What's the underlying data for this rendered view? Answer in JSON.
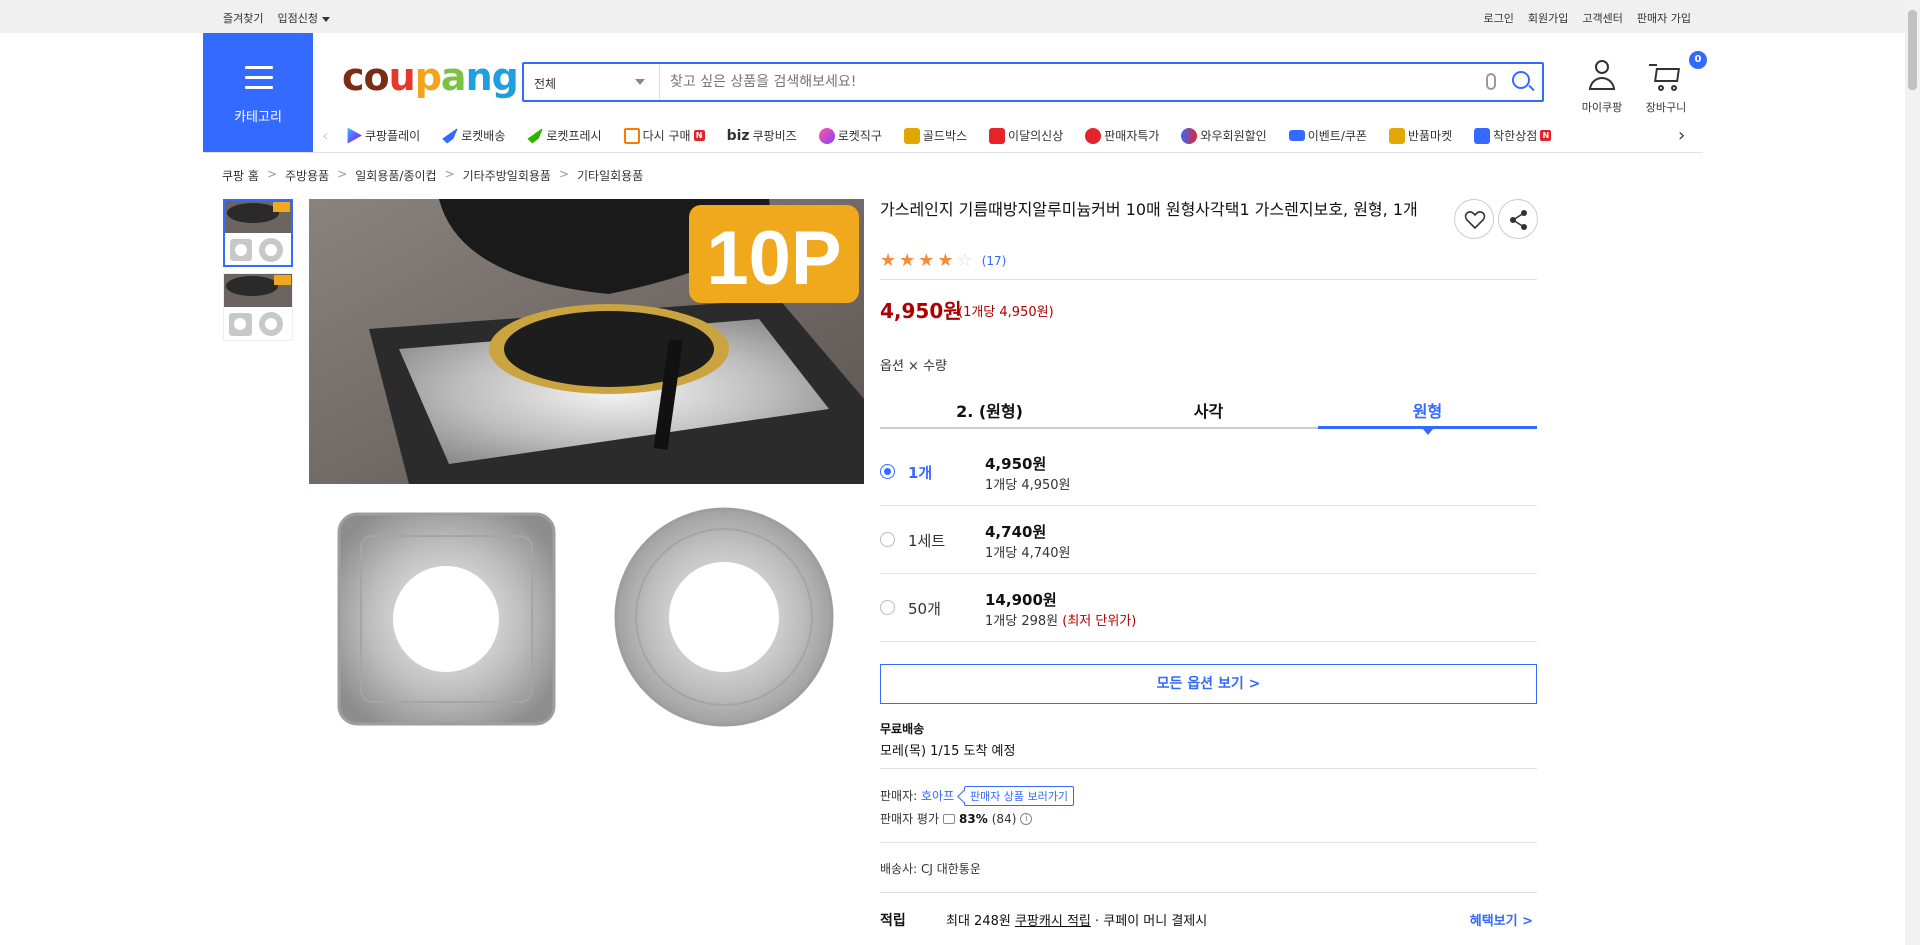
{
  "topbar": {
    "left": [
      "즐겨찾기",
      "입점신청"
    ],
    "right": [
      "로그인",
      "회원가입",
      "고객센터",
      "판매자 가입"
    ]
  },
  "header": {
    "category_label": "카테고리",
    "logo": [
      "c",
      "o",
      "u",
      "p",
      "a",
      "n",
      "g"
    ],
    "search_scope": "전체",
    "search_placeholder": "찾고 싶은 상품을 검색해보세요!",
    "mycoupang_label": "마이쿠팡",
    "cart_label": "장바구니",
    "cart_count": "0"
  },
  "nav": {
    "items": [
      {
        "label": "쿠팡플레이",
        "icon": "play-icon",
        "color": "#6a4cff"
      },
      {
        "label": "로켓배송",
        "icon": "rocket-icon",
        "color": "#346aff"
      },
      {
        "label": "로켓프레시",
        "icon": "rocket-fresh-icon",
        "color": "#2db400"
      },
      {
        "label": "다시 구매",
        "icon": "house-icon",
        "color": "#f57c00"
      },
      {
        "label": "쿠팡비즈",
        "icon": "biz-icon",
        "color": "#333"
      },
      {
        "label": "로켓직구",
        "icon": "globe-icon",
        "color": "#8a3ffc"
      },
      {
        "label": "골드박스",
        "icon": "gold-box-icon",
        "color": "#e0a800"
      },
      {
        "label": "이달의신상",
        "icon": "new-bag-icon",
        "color": "#e4232b"
      },
      {
        "label": "판매자특가",
        "icon": "percent-icon",
        "color": "#e4232b"
      },
      {
        "label": "와우회원할인",
        "icon": "wow-icon",
        "color": "#346aff"
      },
      {
        "label": "이벤트/쿠폰",
        "icon": "coupon-icon",
        "color": "#346aff"
      },
      {
        "label": "반품마켓",
        "icon": "market-icon",
        "color": "#e0a800"
      },
      {
        "label": "착한상점",
        "icon": "shop-icon",
        "color": "#346aff"
      }
    ],
    "biz_prefix": "biz",
    "new_tag": "N"
  },
  "breadcrumb": [
    "쿠팡 홈",
    "주방용품",
    "일회용품/종이컵",
    "기타주방일회용품",
    "기타일회용품"
  ],
  "product": {
    "title": "가스레인지 기름때방지알루미늄커버 10매 원형사각택1 가스렌지보호, 원형, 1개",
    "rating": 4,
    "review_count": "(17)",
    "price": "4,950원",
    "unit_price": "(1개당 4,950원)",
    "option_label": "옵션 × 수량",
    "image_badge": "10P",
    "tabs": [
      {
        "label": "2. (원형)",
        "active": false
      },
      {
        "label": "사각",
        "active": false
      },
      {
        "label": "원형",
        "active": true
      }
    ],
    "options": [
      {
        "name": "1개",
        "price": "4,950원",
        "unit": "1개당 4,950원",
        "tag": "",
        "selected": true
      },
      {
        "name": "1세트",
        "price": "4,740원",
        "unit": "1개당 4,740원",
        "tag": "",
        "selected": false
      },
      {
        "name": "50개",
        "price": "14,900원",
        "unit": "1개당 298원",
        "tag": "(최저 단위가)",
        "selected": false
      }
    ],
    "all_options_button": "모든 옵션 보기 >",
    "shipping_title": "무료배송",
    "shipping_date": "모레(목) 1/15 도착 예정",
    "seller_label": "판매자:",
    "seller_name": "호아프",
    "seller_more": "판매자 상품 보러가기",
    "seller_rating_label": "판매자 평가",
    "seller_rating_value": "83%",
    "seller_rating_count": "(84)",
    "carrier": "배송사:  CJ 대한통운",
    "reward_label": "적립",
    "reward_text_pre": "최대 248원 ",
    "reward_text_link": "쿠팡캐시 적립",
    "reward_text_post": " · 쿠페이 머니 결제시",
    "reward_button": "혜택보기 >"
  }
}
